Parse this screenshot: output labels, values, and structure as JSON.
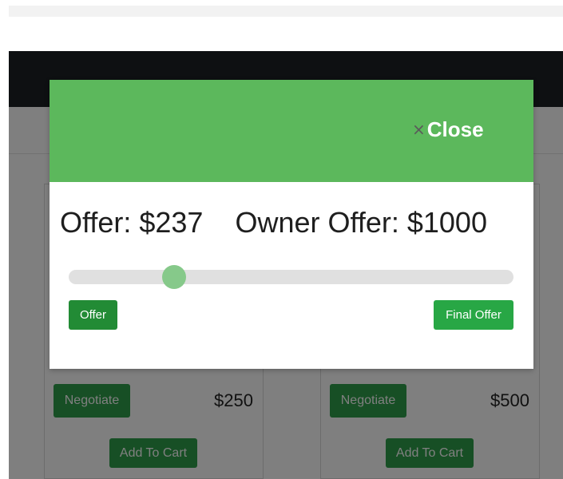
{
  "cards": [
    {
      "negotiate_label": "Negotiate",
      "price": "$250",
      "cart_label": "Add To Cart"
    },
    {
      "negotiate_label": "Negotiate",
      "price": "$500",
      "cart_label": "Add To Cart"
    }
  ],
  "modal": {
    "close_icon": "×",
    "close_label": "Close",
    "offer_text": "Offer: $237",
    "owner_offer_text": "Owner Offer: $1000",
    "slider": {
      "value": 237,
      "min": 0,
      "max": 1000
    },
    "offer_button": "Offer",
    "final_offer_button": "Final Offer"
  },
  "colors": {
    "header_green": "#5cb85c",
    "button_green": "#28a745",
    "navbar": "#1d2124"
  }
}
